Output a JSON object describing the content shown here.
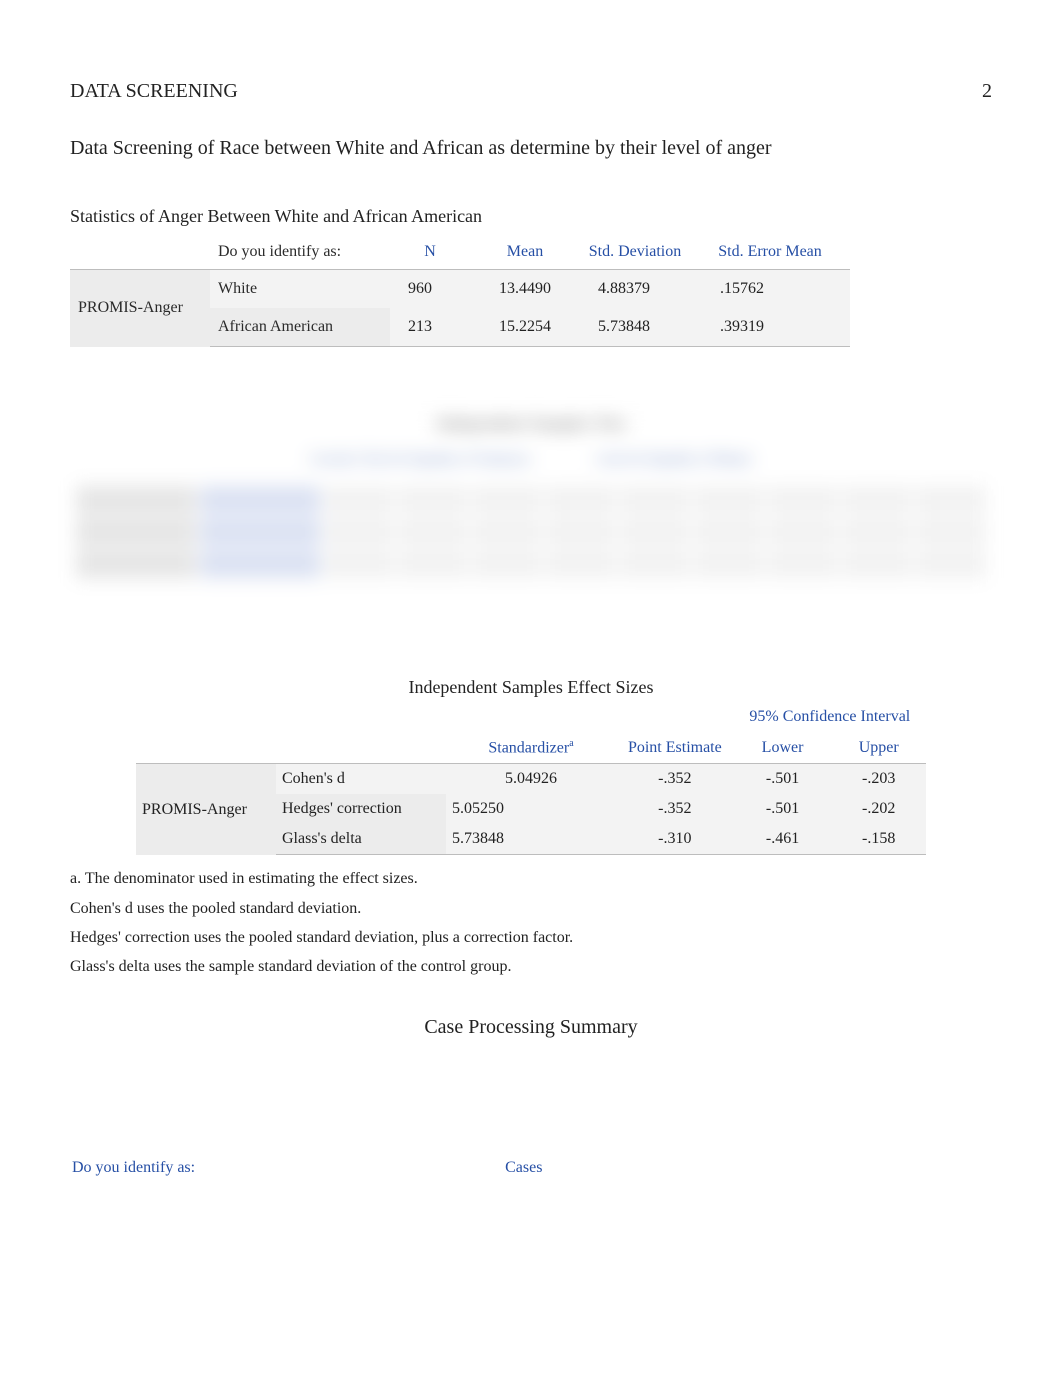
{
  "header": {
    "running_head": "DATA SCREENING",
    "page_number": "2"
  },
  "title": "Data Screening of Race between White and African as determine by their level of anger",
  "stats_table": {
    "title": "Statistics of Anger Between White and African American",
    "headers": {
      "identify": "Do you identify as:",
      "n": "N",
      "mean": "Mean",
      "sd": "Std. Deviation",
      "sem": "Std. Error Mean"
    },
    "variable": "PROMIS-Anger",
    "rows": [
      {
        "group": "White",
        "n": "960",
        "mean": "13.4490",
        "sd": "4.88379",
        "sem": ".15762"
      },
      {
        "group": "African American",
        "n": "213",
        "mean": "15.2254",
        "sd": "5.73848",
        "sem": ".39319"
      }
    ]
  },
  "effect_table": {
    "title": "Independent Samples Effect Sizes",
    "ci_label": "95% Confidence Interval",
    "headers": {
      "standardizer": "Standardizer",
      "sup": "a",
      "point": "Point Estimate",
      "lower": "Lower",
      "upper": "Upper"
    },
    "variable": "PROMIS-Anger",
    "rows": [
      {
        "metric": "Cohen's d",
        "std": "5.04926",
        "point": "-.352",
        "lower": "-.501",
        "upper": "-.203"
      },
      {
        "metric": "Hedges' correction",
        "std": "5.05250",
        "point": "-.352",
        "lower": "-.501",
        "upper": "-.202"
      },
      {
        "metric": "Glass's delta",
        "std": "5.73848",
        "point": "-.310",
        "lower": "-.461",
        "upper": "-.158"
      }
    ],
    "notes": {
      "a": "a. The denominator used in estimating the effect sizes.",
      "b": "Cohen's d uses the pooled standard deviation.",
      "c": "Hedges' correction uses the pooled standard deviation, plus a correction factor.",
      "d": "Glass's delta uses the sample standard deviation of the control group."
    }
  },
  "cps": {
    "title": "Case Processing Summary",
    "identify": "Do you identify as:",
    "cases": "Cases"
  }
}
